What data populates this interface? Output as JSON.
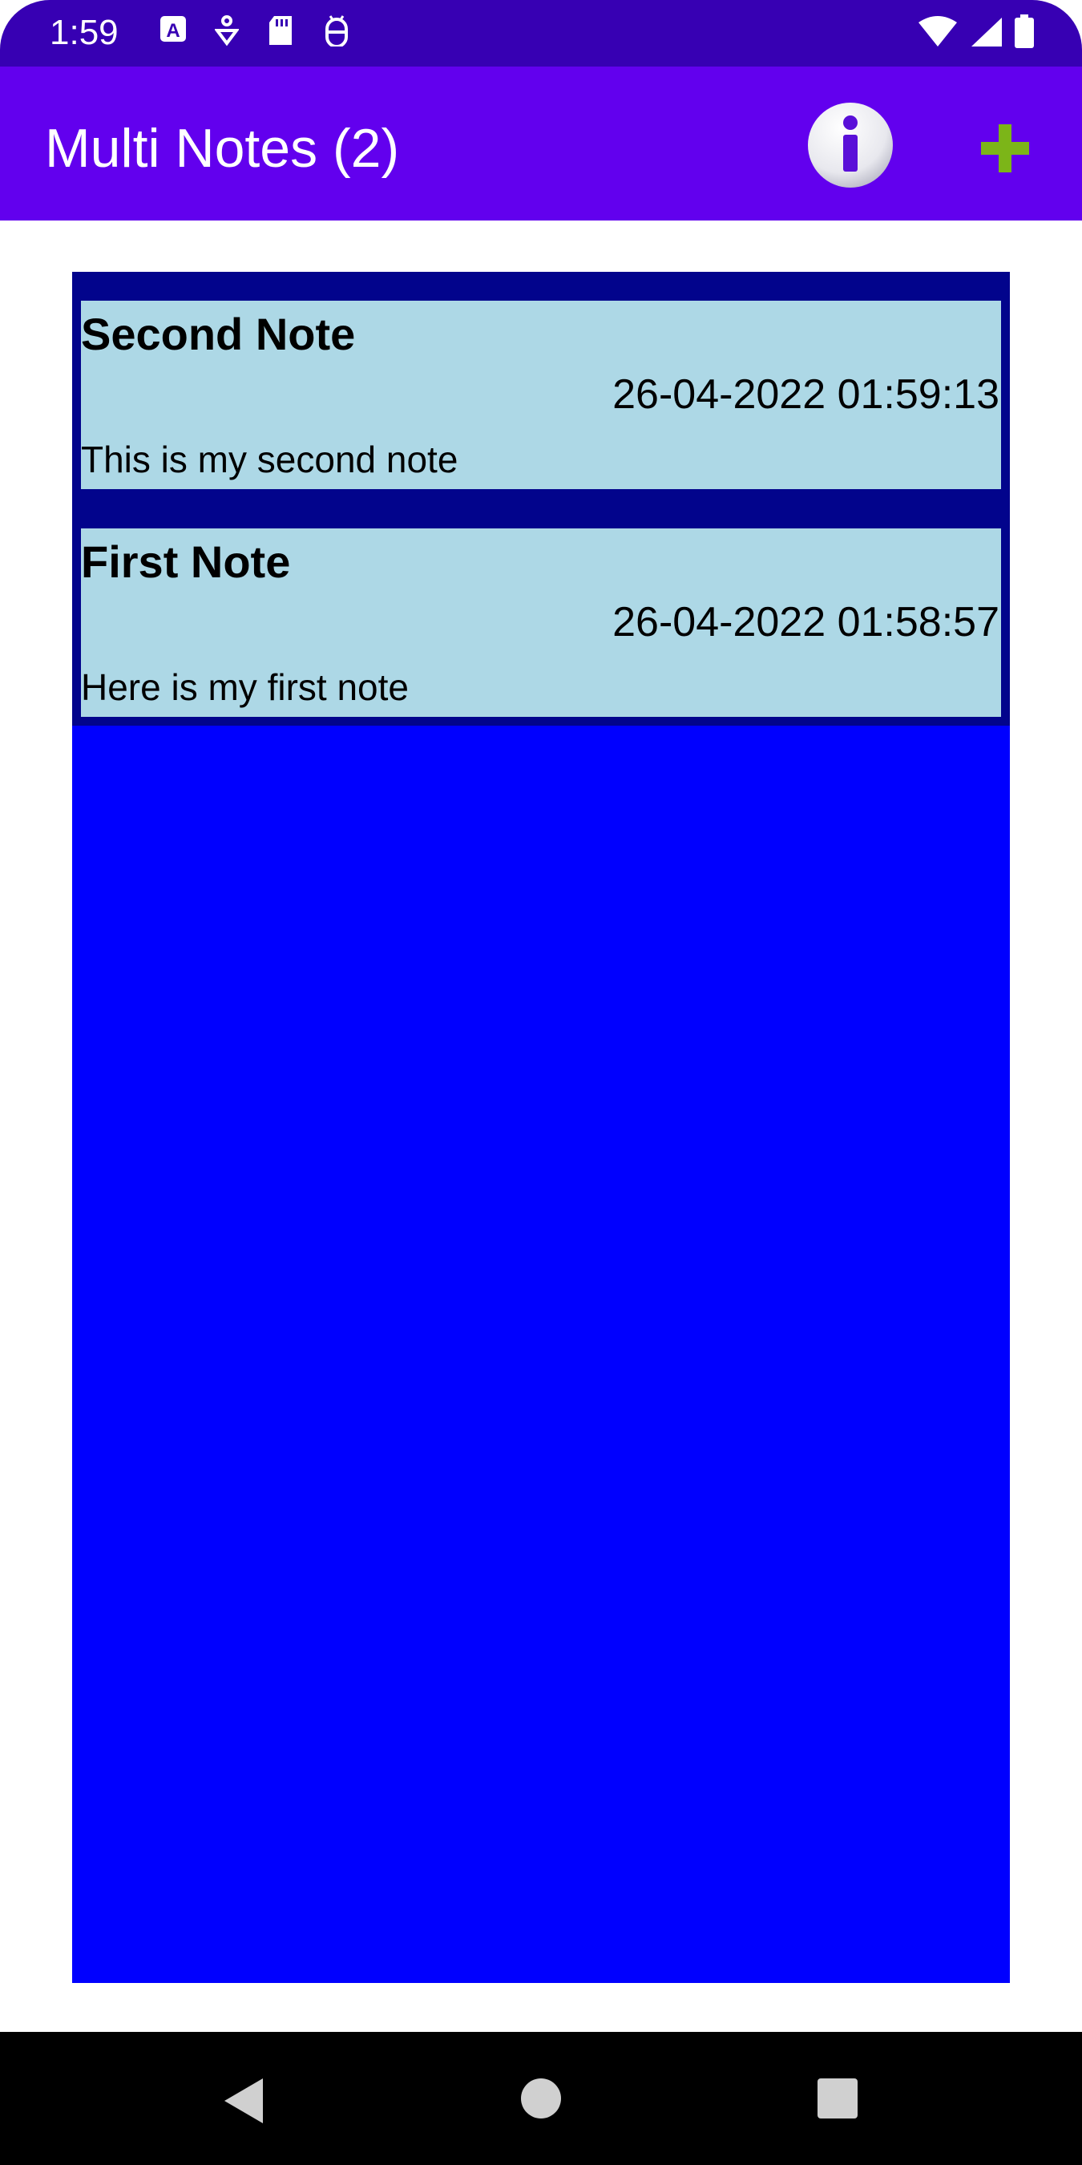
{
  "status_bar": {
    "time": "1:59",
    "left_icons": [
      "a-notification-icon",
      "assistant-icon",
      "sd-card-icon",
      "android-debug-icon"
    ],
    "right_icons": [
      "wifi-icon",
      "cellular-signal-icon",
      "battery-icon"
    ]
  },
  "app_bar": {
    "title": "Multi Notes (2)",
    "actions": [
      {
        "name": "info",
        "icon": "info-icon"
      },
      {
        "name": "add",
        "icon": "plus-icon"
      }
    ]
  },
  "notes": [
    {
      "title": "Second Note",
      "timestamp": "26-04-2022 01:59:13",
      "body": "This is my second note"
    },
    {
      "title": "First Note",
      "timestamp": "26-04-2022 01:58:57",
      "body": "Here is my first note"
    }
  ],
  "nav_bar": {
    "buttons": [
      "back-icon",
      "home-icon",
      "recents-icon"
    ]
  },
  "colors": {
    "status_bar": "#3700b3",
    "app_bar": "#6200ee",
    "list_background": "#0000ff",
    "list_header": "#02048c",
    "note_card": "#add8e6",
    "add_icon": "#7cb518"
  }
}
